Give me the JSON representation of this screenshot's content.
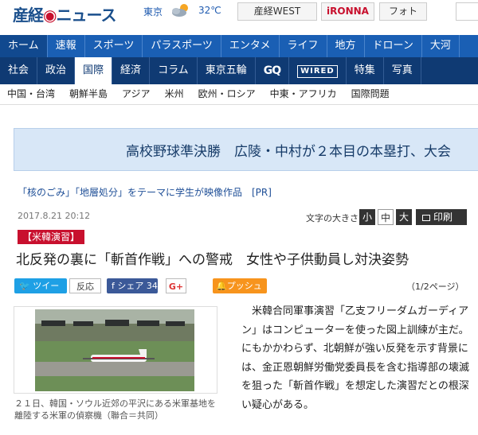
{
  "header": {
    "logo_text": "産経",
    "logo_suffix": "ニュース",
    "weather_city": "東京",
    "weather_icon": "cloud-sun-icon",
    "temperature": "32℃",
    "links": [
      "産経WEST",
      "iRONNA",
      "フォト"
    ]
  },
  "nav_primary": [
    "ホーム",
    "速報",
    "スポーツ",
    "パラスポーツ",
    "エンタメ",
    "ライフ",
    "地方",
    "ドローン",
    "大河"
  ],
  "nav_secondary": [
    "社会",
    "政治",
    "国際",
    "経済",
    "コラム",
    "東京五輪",
    "GQ",
    "WIRED",
    "特集",
    "写真"
  ],
  "nav_secondary_active": "国際",
  "nav_region": [
    "中国・台湾",
    "朝鮮半島",
    "アジア",
    "米州",
    "欧州・ロシア",
    "中東・アフリカ",
    "国際問題"
  ],
  "banner_text": "高校野球準決勝　広陵・中村が２本目の本塁打、大会",
  "pr_text": "「核のごみ」「地層処分」をテーマに学生が映像作品　[PR]",
  "article": {
    "date": "2017.8.21 20:12",
    "fontsize_label": "文字の大きさ",
    "fontsize_small": "小",
    "fontsize_medium": "中",
    "fontsize_large": "大",
    "print_label": "印刷",
    "tag": "【米韓演習】",
    "headline": "北反発の裏に「斬首作戦」への警戒　女性や子供動員し対決姿勢",
    "tweet_label": "ツイート",
    "hanno_label": "反応",
    "share_label": "シェア",
    "share_count": "34",
    "gplus_label": "G+",
    "push_label": "プッシュ通知",
    "page_indicator": "（1/2ページ）",
    "photo_caption": "２１日、韓国・ソウル近郊の平沢にある米軍基地を離陸する米軍の偵察機（聯合＝共同）",
    "body": "米韓合同軍事演習「乙支フリーダムガーディアン」はコンピューターを使った図上訓練が主だ。にもかかわらず、北朝鮮が強い反発を示す背景には、金正恩朝鮮労働党委員長を含む指導部の壊滅を狙った「斬首作戦」を想定した演習だとの根深い疑心がある。"
  },
  "colors": {
    "brand_blue": "#1a5fb4",
    "brand_navy": "#0f3a73",
    "accent_red": "#c8102e",
    "twitter": "#1ea0e5",
    "facebook": "#3b5998",
    "push_orange": "#f7941d"
  }
}
